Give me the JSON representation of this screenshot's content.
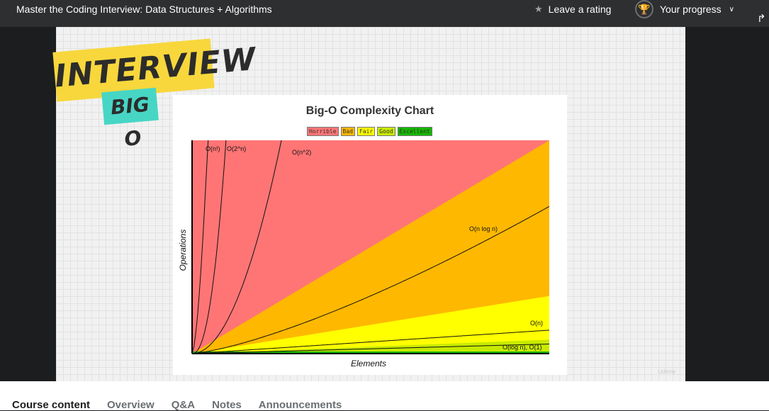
{
  "header": {
    "course_title": "Master the Coding Interview: Data Structures + Algorithms",
    "rating_label": "Leave a rating",
    "progress_label": "Your progress"
  },
  "slide": {
    "banner_text": "INTERVIEW",
    "banner_sub": "BIG O",
    "watermark": "Udemy"
  },
  "chart_data": {
    "type": "area",
    "title": "Big-O Complexity Chart",
    "xlabel": "Elements",
    "ylabel": "Operations",
    "legend": [
      {
        "label": "Horrible",
        "color": "#ff7575"
      },
      {
        "label": "Bad",
        "color": "#ffb800"
      },
      {
        "label": "Fair",
        "color": "#ffff00"
      },
      {
        "label": "Good",
        "color": "#c8ea00"
      },
      {
        "label": "Excellent",
        "color": "#15b700"
      }
    ],
    "regions": [
      {
        "name": "Horrible",
        "color": "#ff7575"
      },
      {
        "name": "Bad",
        "color": "#ffb800"
      },
      {
        "name": "Fair",
        "color": "#ffff00"
      },
      {
        "name": "Good",
        "color": "#c8ea00"
      },
      {
        "name": "Excellent",
        "color": "#15b700"
      }
    ],
    "curves": [
      {
        "label": "O(n!)"
      },
      {
        "label": "O(2^n)"
      },
      {
        "label": "O(n^2)"
      },
      {
        "label": "O(n log n)"
      },
      {
        "label": "O(n)"
      },
      {
        "label": "O(log n), O(1)"
      }
    ]
  },
  "tabs": [
    "Course content",
    "Overview",
    "Q&A",
    "Notes",
    "Announcements"
  ]
}
